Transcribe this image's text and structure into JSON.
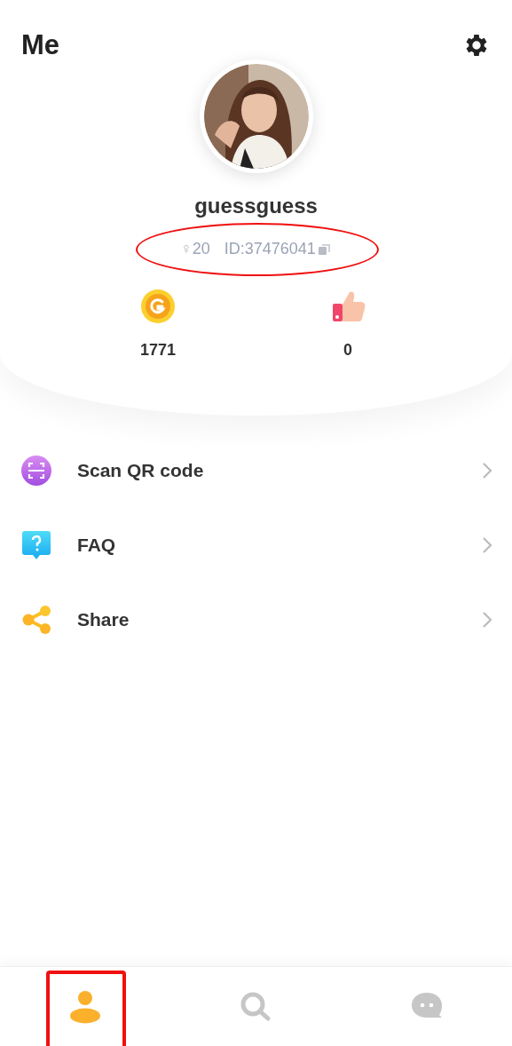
{
  "header": {
    "title": "Me"
  },
  "profile": {
    "username": "guessguess",
    "gender_symbol": "♀",
    "age": "20",
    "id": "ID:37476041"
  },
  "stats": [
    {
      "kind": "coins",
      "value": "1771"
    },
    {
      "kind": "likes",
      "value": "0"
    }
  ],
  "menu": [
    {
      "kind": "scan",
      "label": "Scan QR code"
    },
    {
      "kind": "faq",
      "label": "FAQ"
    },
    {
      "kind": "share",
      "label": "Share"
    }
  ],
  "tab_bar": [
    {
      "kind": "profile",
      "selected": true
    },
    {
      "kind": "search",
      "selected": false
    },
    {
      "kind": "messages",
      "selected": false
    }
  ],
  "annotations": [
    {
      "kind": "ellipse"
    },
    {
      "kind": "rectangle"
    }
  ]
}
